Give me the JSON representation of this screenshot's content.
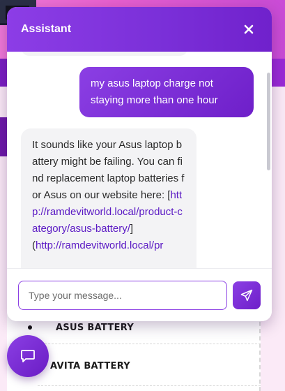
{
  "chat": {
    "title": "Assistant",
    "messages": [
      {
        "role": "user",
        "text": "my asus laptop charge not staying more than one hour"
      },
      {
        "role": "assistant",
        "text": "It sounds like your Asus laptop battery might be failing. You can find replacement laptop batteries for Asus on our website here: ",
        "link_bracket_open": "[",
        "link_text": "http://ramdevitworld.local/product-category/asus-battery/",
        "link_bracket_close": "]",
        "link_paren_open": "(",
        "link_url": "http://ramdevitworld.local/pr"
      }
    ],
    "input": {
      "placeholder": "Type your message...",
      "value": ""
    }
  },
  "background": {
    "categories": [
      {
        "label": "ASUS BATTERY"
      },
      {
        "label": "AVITA BATTERY"
      }
    ]
  },
  "colors": {
    "accent": "#7a2fd8",
    "accent_dark": "#6e1fc9",
    "bubble_bot": "#f3f3f5",
    "link": "#5a19c4"
  },
  "icons": {
    "close": "close-icon",
    "send": "send-icon",
    "launcher": "chat-bubble-icon"
  }
}
